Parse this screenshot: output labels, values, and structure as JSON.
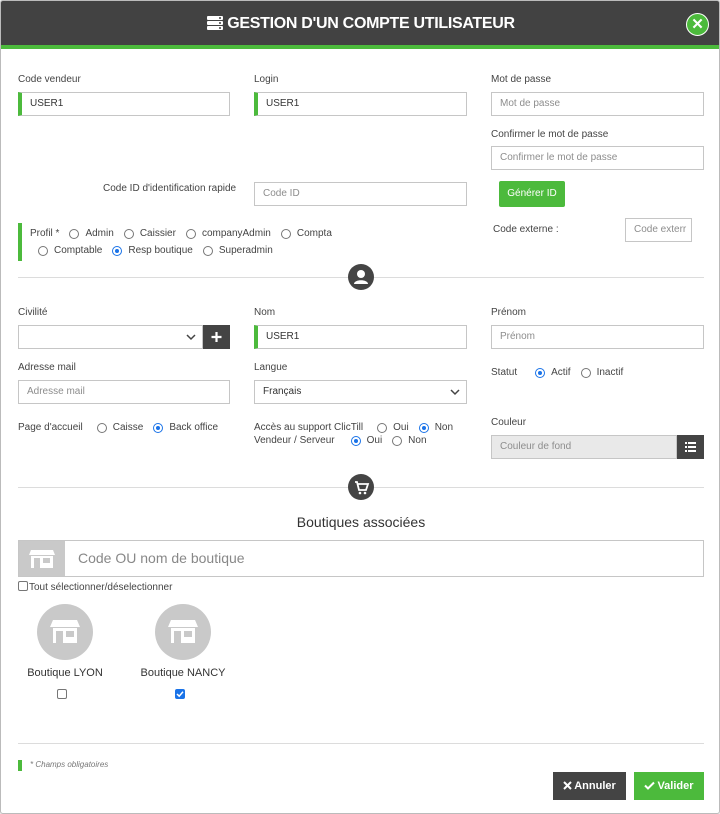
{
  "header": {
    "title": "GESTION D'UN COMPTE UTILISATEUR",
    "close_symbol": "✕"
  },
  "account": {
    "code_vendeur": {
      "label": "Code vendeur",
      "value": "USER1"
    },
    "login": {
      "label": "Login",
      "value": "USER1"
    },
    "mot_de_passe": {
      "label": "Mot de passe",
      "placeholder": "Mot de passe"
    },
    "confirmer": {
      "label": "Confirmer le mot de passe",
      "placeholder": "Confirmer le mot de passe"
    },
    "code_id": {
      "label": "Code ID d'identification rapide",
      "placeholder": "Code ID"
    },
    "generer_label": "Générer ID",
    "code_externe": {
      "label": "Code externe :",
      "placeholder": "Code exterr"
    },
    "profil": {
      "label": "Profil *",
      "options": [
        "Admin",
        "Caissier",
        "companyAdmin",
        "Compta",
        "Comptable",
        "Resp boutique",
        "Superadmin"
      ],
      "selected": "Resp boutique"
    }
  },
  "person": {
    "civilite": {
      "label": "Civilité",
      "value": ""
    },
    "nom": {
      "label": "Nom",
      "value": "USER1"
    },
    "prenom": {
      "label": "Prénom",
      "placeholder": "Prénom"
    },
    "adresse_mail": {
      "label": "Adresse mail",
      "placeholder": "Adresse mail"
    },
    "langue": {
      "label": "Langue",
      "value": "Français"
    },
    "statut": {
      "label": "Statut",
      "options": [
        "Actif",
        "Inactif"
      ],
      "selected": "Actif"
    },
    "page_accueil": {
      "label": "Page d'accueil",
      "options": [
        "Caisse",
        "Back office"
      ],
      "selected": "Back office"
    },
    "acces_support": {
      "label": "Accès au support ClicTill",
      "options": [
        "Oui",
        "Non"
      ],
      "selected": "Non"
    },
    "vendeur_serveur": {
      "label": "Vendeur / Serveur",
      "options": [
        "Oui",
        "Non"
      ],
      "selected": "Oui"
    },
    "couleur": {
      "label": "Couleur",
      "placeholder": "Couleur de fond"
    }
  },
  "boutiques": {
    "title": "Boutiques associées",
    "search_placeholder": "Code OU nom de boutique",
    "select_all_label": "Tout sélectionner/déselectionner",
    "items": [
      {
        "name": "Boutique LYON",
        "checked": false
      },
      {
        "name": "Boutique NANCY",
        "checked": true
      }
    ]
  },
  "footer": {
    "required_note": "* Champs obligatoires",
    "cancel_label": "Annuler",
    "validate_label": "Valider"
  },
  "colors": {
    "accent": "#4cba3c",
    "header_bg": "#424242",
    "dark_button": "#444444",
    "radio_checked": "#1a73e8"
  }
}
